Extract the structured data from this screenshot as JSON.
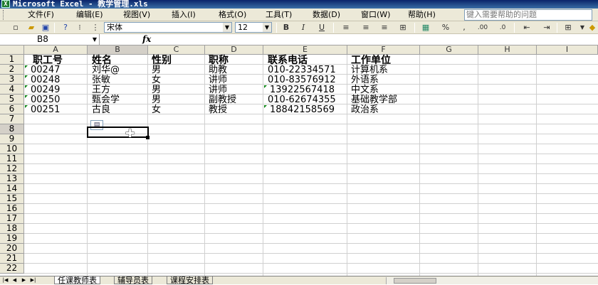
{
  "window": {
    "title": "Microsoft Excel - 教学管理.xls"
  },
  "menu": [
    "文件(F)",
    "编辑(E)",
    "视图(V)",
    "插入(I)",
    "格式(O)",
    "工具(T)",
    "数据(D)",
    "窗口(W)",
    "帮助(H)"
  ],
  "help_placeholder": "键入需要帮助的问题",
  "toolbar": {
    "font_name": "宋体",
    "font_size": "12",
    "bold": "B",
    "italic": "I",
    "underline": "U",
    "percent": "%",
    "comma": ","
  },
  "formula_bar": {
    "name_box": "B8",
    "fx": "fx",
    "content": ""
  },
  "columns": [
    "A",
    "B",
    "C",
    "D",
    "E",
    "F",
    "G",
    "H",
    "I"
  ],
  "rows": [
    "1",
    "2",
    "3",
    "4",
    "5",
    "6",
    "7",
    "8",
    "9",
    "10",
    "11",
    "12",
    "13",
    "14",
    "15",
    "16",
    "17",
    "18",
    "19",
    "20",
    "21",
    "22"
  ],
  "table": {
    "headers": [
      "职工号",
      "姓名",
      "性别",
      "职称",
      "联系电话",
      "工作单位"
    ],
    "rows": [
      [
        "00247",
        "刘华@",
        "男",
        "助教",
        "010-22334571",
        "计算机系"
      ],
      [
        "00248",
        "张敏",
        "女",
        "讲师",
        "010-83576912",
        "外语系"
      ],
      [
        "00249",
        "王方",
        "男",
        "讲师",
        "13922567418",
        "中文系"
      ],
      [
        "00250",
        "甄会学",
        "男",
        "副教授",
        "010-62674355",
        "基础教学部"
      ],
      [
        "00251",
        "古良",
        "女",
        "教授",
        "18842158569",
        "政治系"
      ]
    ]
  },
  "selected_cell": "B8",
  "sheets": [
    "任课教师表",
    "辅导员表",
    "课程安排表"
  ],
  "active_sheet": "任课教师表"
}
